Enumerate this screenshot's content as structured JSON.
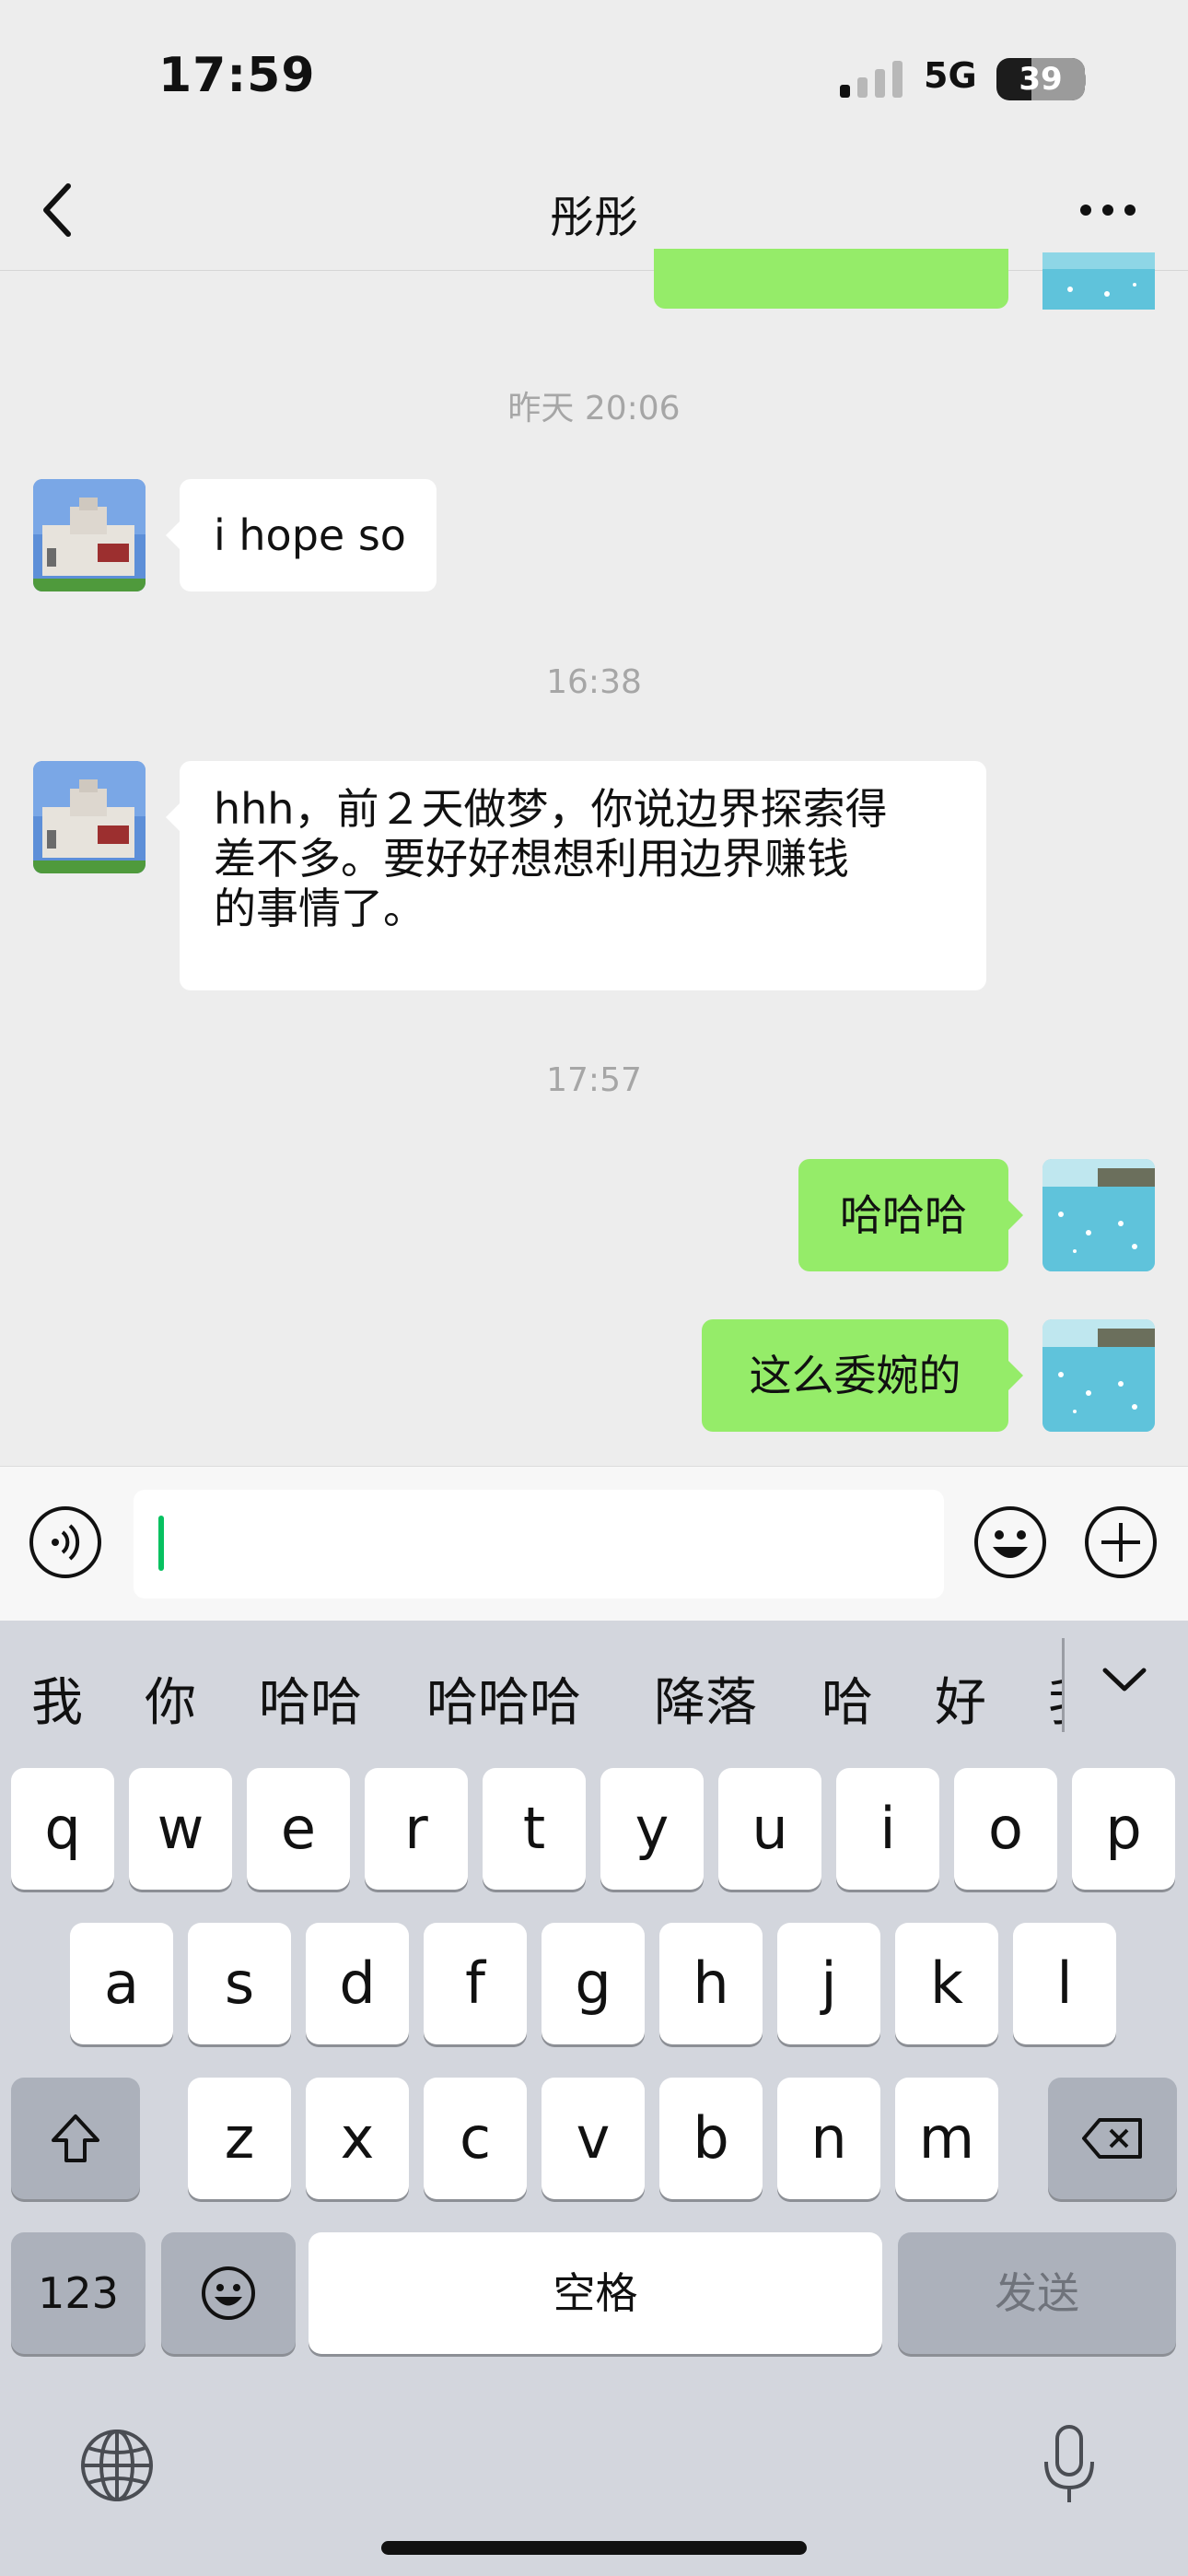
{
  "status_bar": {
    "time": "17:59",
    "network": "5G",
    "battery": "39"
  },
  "nav": {
    "title": "彤彤"
  },
  "messages": [
    {
      "type": "timestamp",
      "text": "昨天 20:06"
    },
    {
      "type": "in",
      "text": "i hope so"
    },
    {
      "type": "timestamp",
      "text": "16:38"
    },
    {
      "type": "in",
      "lines": [
        "hhh，前２天做梦，你说边界探索得",
        "差不多。要好好想想利用边界赚钱",
        "的事情了。"
      ]
    },
    {
      "type": "timestamp",
      "text": "17:57"
    },
    {
      "type": "out",
      "text": "哈哈哈"
    },
    {
      "type": "out",
      "text": "这么委婉的"
    }
  ],
  "candidates": [
    "我",
    "你",
    "哈哈",
    "哈哈哈",
    "降落",
    "哈",
    "好",
    "我"
  ],
  "keyboard": {
    "row1": [
      "q",
      "w",
      "e",
      "r",
      "t",
      "y",
      "u",
      "i",
      "o",
      "p"
    ],
    "row2": [
      "a",
      "s",
      "d",
      "f",
      "g",
      "h",
      "j",
      "k",
      "l"
    ],
    "row3": [
      "z",
      "x",
      "c",
      "v",
      "b",
      "n",
      "m"
    ],
    "numbers_key": "123",
    "space_key": "空格",
    "send_key": "发送"
  },
  "icons": {
    "back": "chevron-left-icon",
    "more": "more-icon",
    "voice": "voice-icon",
    "emoji": "emoji-icon",
    "plus": "plus-icon",
    "shift": "shift-icon",
    "delete": "delete-icon",
    "globe": "globe-icon",
    "mic": "microphone-icon"
  },
  "colors": {
    "outgoing_bubble": "#95ec69",
    "incoming_bubble": "#ffffff",
    "cursor": "#07c160"
  }
}
